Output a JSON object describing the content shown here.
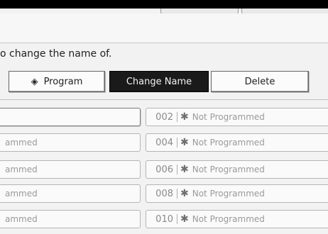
{
  "instruction": "o change the name of.",
  "buttons": {
    "program": "Program",
    "program_icon": "program-diamond-icon",
    "change_name": "Change Name",
    "delete": "Delete"
  },
  "left_slots": [
    {
      "label": ""
    },
    {
      "label": "ammed"
    },
    {
      "label": "ammed"
    },
    {
      "label": "ammed"
    },
    {
      "label": "ammed"
    }
  ],
  "right_slots": [
    {
      "number": "002",
      "label": "Not Programmed"
    },
    {
      "number": "004",
      "label": "Not Programmed"
    },
    {
      "number": "006",
      "label": "Not Programmed"
    },
    {
      "number": "008",
      "label": "Not Programmed"
    },
    {
      "number": "010",
      "label": "Not Programmed"
    }
  ],
  "colors": {
    "selected_bg": "#1a1a1a",
    "top_bar": "#000000",
    "slot_text": "#9a9a9a"
  }
}
